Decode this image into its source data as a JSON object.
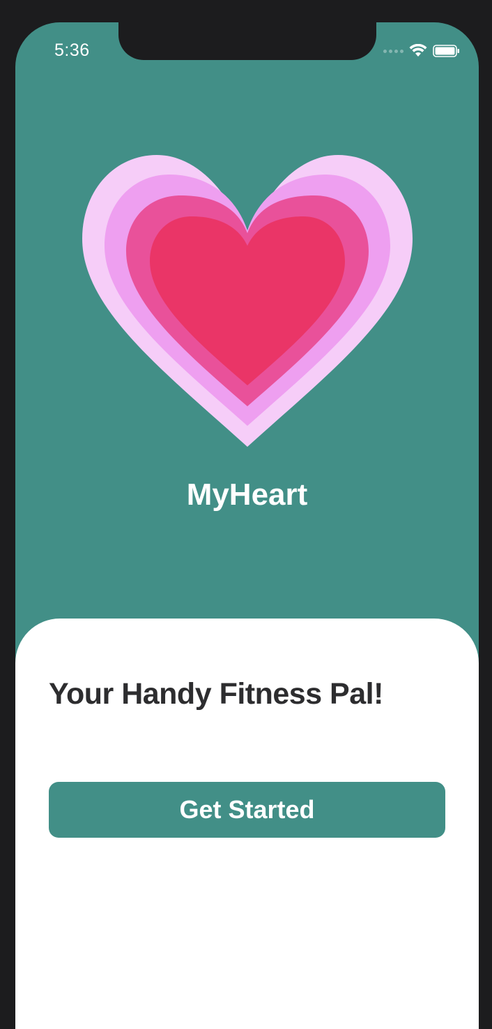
{
  "status_bar": {
    "time": "5:36",
    "signal_icon": "cellular-signal-icon",
    "wifi_icon": "wifi-icon",
    "battery_icon": "battery-icon"
  },
  "hero": {
    "heart_icon": "layered-heart-icon",
    "app_name": "MyHeart"
  },
  "sheet": {
    "tagline": "Your Handy Fitness Pal!",
    "get_started_label": "Get Started"
  },
  "colors": {
    "brand_teal": "#428f87",
    "heart_outer": "#f6cdf8",
    "heart_mid": "#ee9ff0",
    "heart_inner": "#e9519a",
    "heart_core": "#ea3567",
    "sheet_bg": "#ffffff",
    "text_dark": "#2d2d2f"
  }
}
